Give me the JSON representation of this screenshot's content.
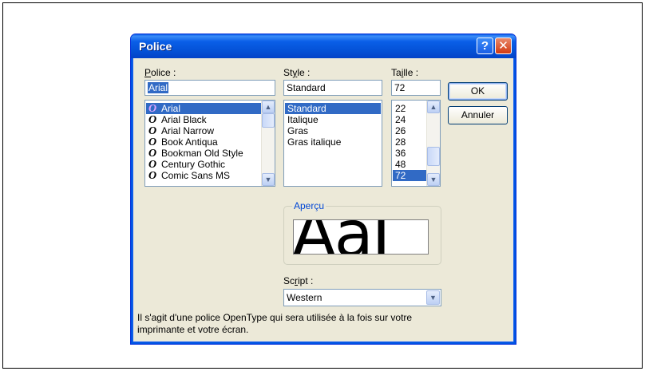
{
  "dialog": {
    "title": "Police",
    "help_icon": "help-icon",
    "close_icon": "close-icon"
  },
  "font": {
    "label_u": "P",
    "label_rest": "olice :",
    "value": "Arial",
    "items": [
      "Arial",
      "Arial Black",
      "Arial Narrow",
      "Book Antiqua",
      "Bookman Old Style",
      "Century Gothic",
      "Comic Sans MS"
    ],
    "selected": "Arial",
    "item_icon": "opentype-icon"
  },
  "style": {
    "label_pre": "St",
    "label_u": "y",
    "label_rest": "le :",
    "value": "Standard",
    "items": [
      "Standard",
      "Italique",
      "Gras",
      "Gras italique"
    ],
    "selected": "Standard"
  },
  "size": {
    "label_pre": "Ta",
    "label_u": "i",
    "label_rest": "lle :",
    "value": "72",
    "items": [
      "22",
      "24",
      "26",
      "28",
      "36",
      "48",
      "72"
    ],
    "selected": "72"
  },
  "buttons": {
    "ok": "OK",
    "cancel": "Annuler"
  },
  "preview": {
    "group_label": "Aperçu",
    "sample": "AaI"
  },
  "script": {
    "label_pre": "Sc",
    "label_u": "r",
    "label_rest": "ipt :",
    "value": "Western"
  },
  "description": {
    "line1": "Il s'agit d'une police OpenType qui sera utilisée à la fois sur votre",
    "line2": "imprimante et votre écran."
  },
  "colors": {
    "title_bar": "#0a5fe8",
    "selection": "#316ac5",
    "dialog_bg": "#ece9d8",
    "group_label": "#0046d5"
  }
}
